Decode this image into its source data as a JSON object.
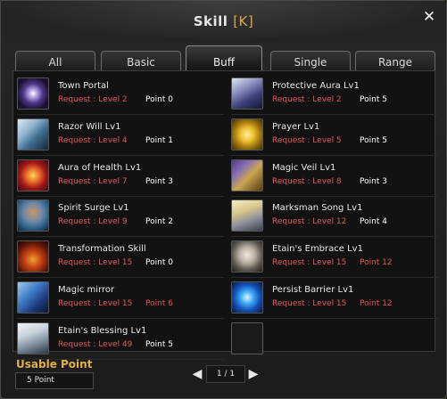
{
  "window": {
    "title": "Skill",
    "hotkey": "[K]"
  },
  "tabs": [
    {
      "label": "All"
    },
    {
      "label": "Basic"
    },
    {
      "label": "Buff"
    },
    {
      "label": "Single"
    },
    {
      "label": "Range"
    }
  ],
  "skills_left": [
    {
      "name": "Town Portal",
      "request": "Request : Level  2",
      "point": "Point  0",
      "icon": "portal-icon"
    },
    {
      "name": "Razor Will Lv1",
      "request": "Request : Level  4",
      "point": "Point  1",
      "icon": "razor-will-icon"
    },
    {
      "name": "Aura of Health Lv1",
      "request": "Request : Level  7",
      "point": "Point  3",
      "icon": "aura-health-icon"
    },
    {
      "name": "Spirit Surge Lv1",
      "request": "Request : Level  9",
      "point": "Point  2",
      "icon": "spirit-surge-icon"
    },
    {
      "name": "Transformation Skill",
      "request": "Request : Level 15",
      "point": "Point  0",
      "icon": "transformation-icon"
    },
    {
      "name": "Magic mirror",
      "request": "Request : Level 15",
      "point": "Point  6",
      "icon": "magic-mirror-icon"
    },
    {
      "name": "Etain's Blessing Lv1",
      "request": "Request : Level 49",
      "point": "Point  5",
      "icon": "etain-blessing-icon"
    }
  ],
  "skills_right": [
    {
      "name": "Protective Aura Lv1",
      "request": "Request : Level  2",
      "point": "Point  5",
      "icon": "protective-aura-icon"
    },
    {
      "name": "Prayer Lv1",
      "request": "Request : Level  5",
      "point": "Point  5",
      "icon": "prayer-icon"
    },
    {
      "name": "Magic Veil Lv1",
      "request": "Request : Level  8",
      "point": "Point  3",
      "icon": "magic-veil-icon"
    },
    {
      "name": "Marksman Song Lv1",
      "request": "Request : Level 12",
      "point": "Point  4",
      "icon": "marksman-song-icon"
    },
    {
      "name": "Etain's Embrace Lv1",
      "request": "Request : Level 15",
      "point": "Point 12",
      "icon": "etain-embrace-icon"
    },
    {
      "name": "Persist Barrier Lv1",
      "request": "Request : Level 15",
      "point": "Point 12",
      "icon": "persist-barrier-icon"
    }
  ],
  "footer": {
    "usable_label": "Usable Point",
    "usable_value": "5 Point",
    "page": "1 / 1"
  },
  "colors": {
    "request_red": "#e0575b",
    "usable_gold": "#e2b043",
    "hotkey_gold": "#d8a84a"
  }
}
